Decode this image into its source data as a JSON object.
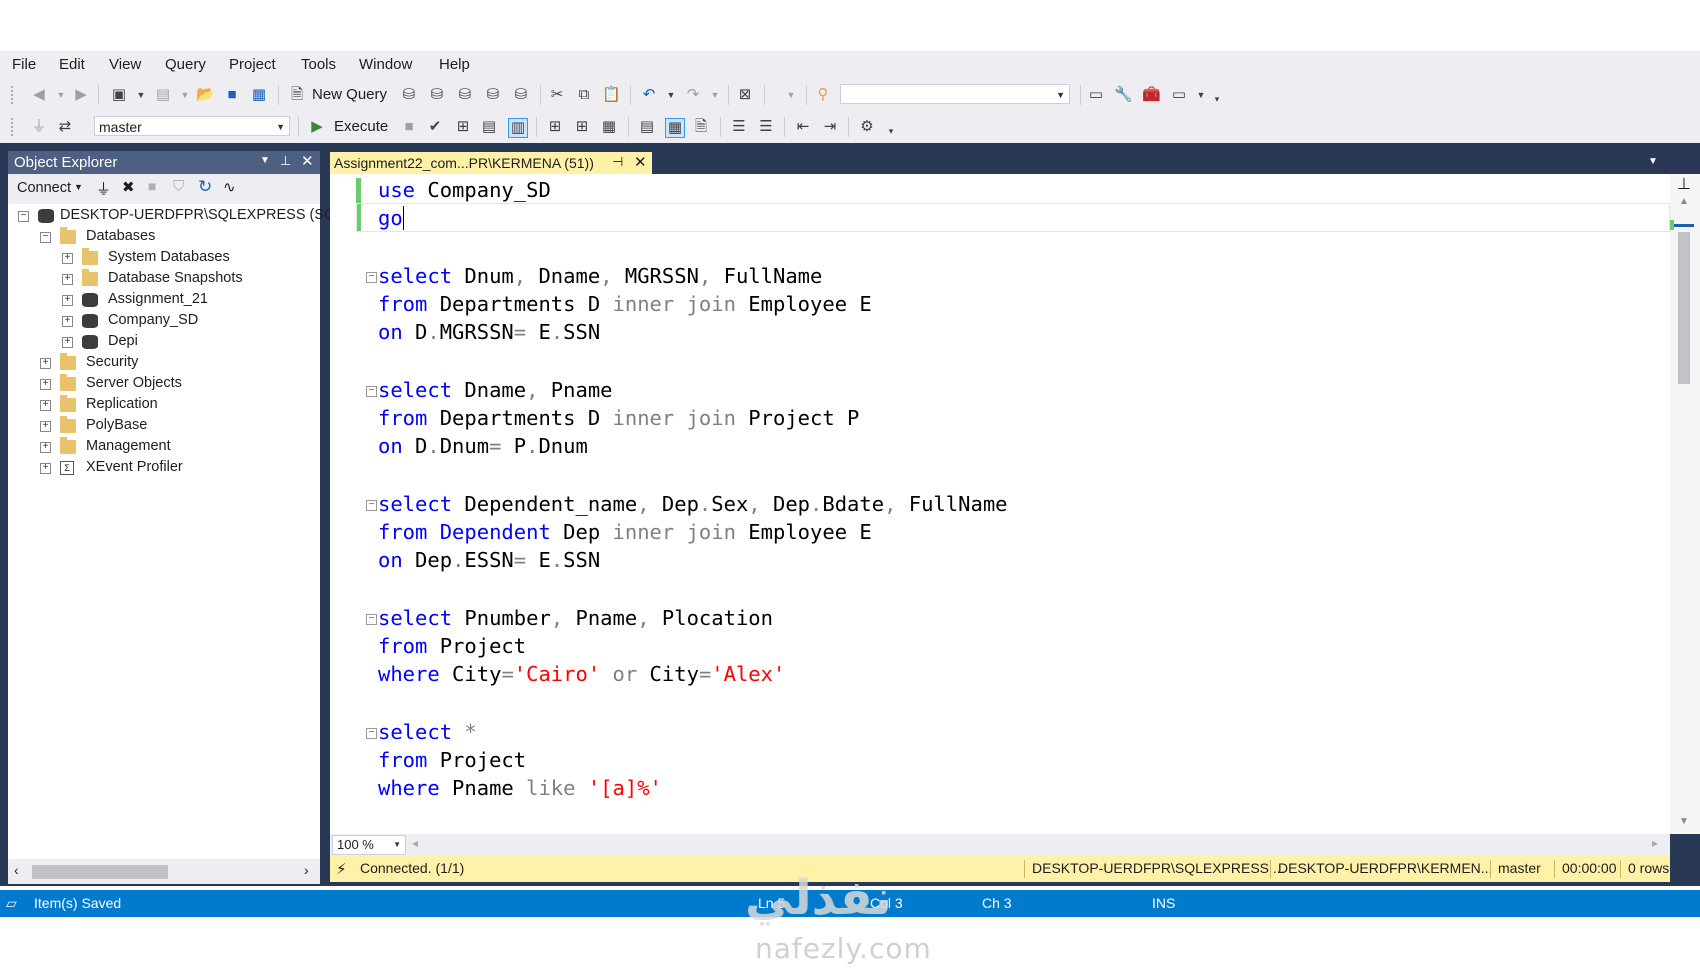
{
  "menubar": {
    "items": [
      "File",
      "Edit",
      "View",
      "Query",
      "Project",
      "Tools",
      "Window",
      "Help"
    ]
  },
  "toolbar1": {
    "new_query_label": "New Query"
  },
  "toolbar2": {
    "database_value": "master",
    "execute_label": "Execute"
  },
  "object_explorer": {
    "title": "Object Explorer",
    "connect_label": "Connect",
    "server": "DESKTOP-UERDFPR\\SQLEXPRESS (SQL",
    "tree": [
      {
        "label": "Databases",
        "level": 1,
        "expander": "−",
        "icon": "folder-icon"
      },
      {
        "label": "System Databases",
        "level": 2,
        "expander": "+",
        "icon": "folder-icon"
      },
      {
        "label": "Database Snapshots",
        "level": 2,
        "expander": "+",
        "icon": "folder-icon"
      },
      {
        "label": "Assignment_21",
        "level": 2,
        "expander": "+",
        "icon": "database-icon"
      },
      {
        "label": "Company_SD",
        "level": 2,
        "expander": "+",
        "icon": "database-icon"
      },
      {
        "label": "Depi",
        "level": 2,
        "expander": "+",
        "icon": "database-icon"
      },
      {
        "label": "Security",
        "level": 1,
        "expander": "+",
        "icon": "folder-icon"
      },
      {
        "label": "Server Objects",
        "level": 1,
        "expander": "+",
        "icon": "folder-icon"
      },
      {
        "label": "Replication",
        "level": 1,
        "expander": "+",
        "icon": "folder-icon"
      },
      {
        "label": "PolyBase",
        "level": 1,
        "expander": "+",
        "icon": "folder-icon"
      },
      {
        "label": "Management",
        "level": 1,
        "expander": "+",
        "icon": "folder-icon"
      },
      {
        "label": "XEvent Profiler",
        "level": 1,
        "expander": "+",
        "icon": "xevent-icon"
      }
    ]
  },
  "editor": {
    "tab_title": "Assignment22_com...PR\\KERMENA (51))",
    "zoom": "100 %",
    "lines": [
      "use Company_SD",
      "go",
      "",
      "select Dnum, Dname, MGRSSN, FullName",
      "from Departments D inner join Employee E",
      "on D.MGRSSN= E.SSN",
      "",
      "select Dname, Pname",
      "from Departments D inner join Project P",
      "on D.Dnum= P.Dnum",
      "",
      "select Dependent_name, Dep.Sex, Dep.Bdate, FullName",
      "from Dependent Dep inner join Employee E",
      "on Dep.ESSN= E.SSN",
      "",
      "select Pnumber, Pname, Plocation",
      "from Project",
      "where City='Cairo' or City='Alex'",
      "",
      "select *",
      "from Project",
      "where Pname like '[a]%'"
    ]
  },
  "statusbar": {
    "connected": "Connected. (1/1)",
    "server": "DESKTOP-UERDFPR\\SQLEXPRESS ...",
    "user": "DESKTOP-UERDFPR\\KERMEN...",
    "database": "master",
    "elapsed": "00:00:00",
    "rows": "0 rows"
  },
  "bottom_bar": {
    "message": "Item(s) Saved",
    "ln": "Ln 5",
    "col": "Col 3",
    "ch": "Ch 3",
    "mode": "INS"
  },
  "watermark": {
    "logo_text": "نفذلي",
    "site": "nafezly.com"
  },
  "colors": {
    "keyword": "#0000ff",
    "string": "#ff0000",
    "operator": "#808080",
    "status_yellow": "#fff1a8",
    "status_blue": "#007acc",
    "panel_title": "#4d6082"
  }
}
